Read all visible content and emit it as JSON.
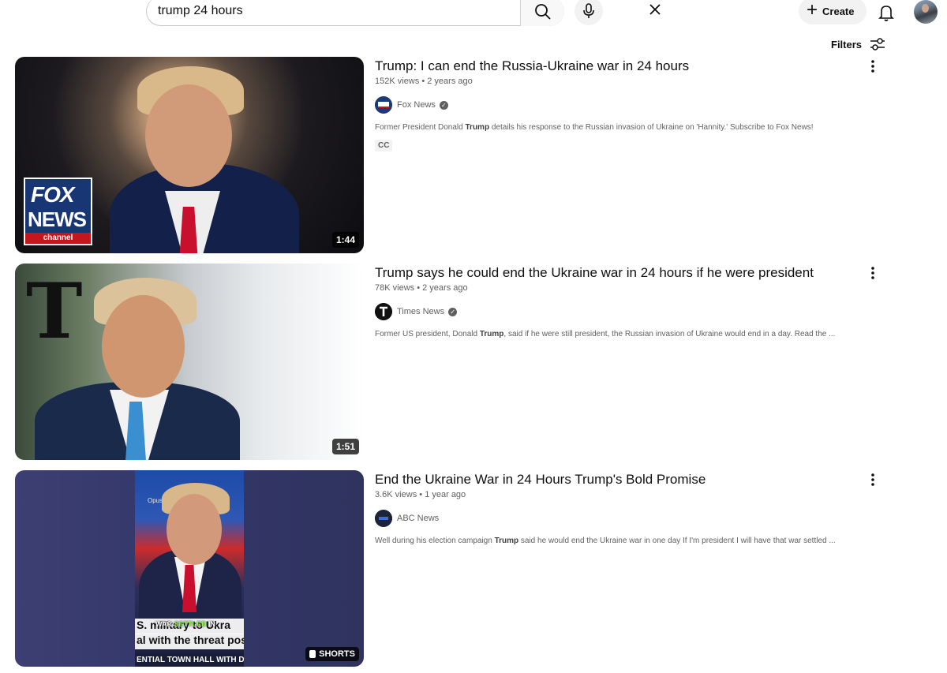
{
  "search": {
    "query": "trump 24 hours"
  },
  "header": {
    "create_label": "Create"
  },
  "filters_label": "Filters",
  "results": [
    {
      "title": "Trump: I can end the Russia-Ukraine war in 24 hours",
      "views": "152K views",
      "age": "2 years ago",
      "channel": "Fox News",
      "verified": true,
      "desc_before": "Former President Donald ",
      "desc_bold": "Trump",
      "desc_after": " details his response to the Russian invasion of Ukraine on 'Hannity.' Subscribe to Fox News!",
      "badge": "CC",
      "duration": "1:44",
      "thumb_logo_line1": "FOX",
      "thumb_logo_line2": "NEWS",
      "thumb_logo_line3": "channel"
    },
    {
      "title": "Trump says he could end the Ukraine war in 24 hours if he were president",
      "views": "78K views",
      "age": "2 years ago",
      "channel": "Times News",
      "verified": true,
      "desc_before": "Former US president, Donald ",
      "desc_bold": "Trump",
      "desc_after": ", said if he were still president, the Russian invasion of Ukraine would end in a day. Read the ...",
      "duration": "1:51",
      "thumb_logo": "T"
    },
    {
      "title": "End the Ukraine War in 24 Hours Trump's Bold Promise",
      "views": "3.6K views",
      "age": "1 year ago",
      "channel": "ABC News",
      "verified": false,
      "desc_before": "Well during his election campaign ",
      "desc_bold": "Trump",
      "desc_after": " said he would end the Ukraine war in one day If I'm president I will have that war settled ...",
      "shorts_label": "SHORTS",
      "thumb_watermark": "OpusClip",
      "caption_highlight_before": "WAR ",
      "caption_highlight": "SETTLED",
      "caption_highlight_after": " IN",
      "caption_line1": "S. military to Ukra",
      "caption_line2": "al with the threat pos",
      "caption_line3": "ENTIAL TOWN HALL WITH DO"
    }
  ],
  "colors": {
    "text_primary": "#0f0f0f",
    "text_secondary": "#606060",
    "chip_bg": "#f2f2f2"
  }
}
